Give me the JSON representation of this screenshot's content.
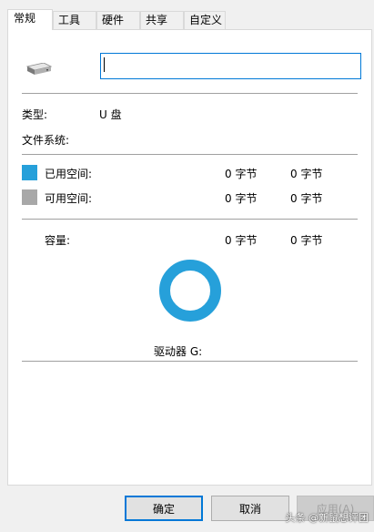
{
  "tabs": [
    {
      "label": "常规",
      "active": true
    },
    {
      "label": "工具",
      "active": false
    },
    {
      "label": "硬件",
      "active": false
    },
    {
      "label": "共享",
      "active": false
    },
    {
      "label": "自定义",
      "active": false
    }
  ],
  "drive": {
    "name_value": "",
    "icon": "usb-drive-icon",
    "type_label": "类型:",
    "type_value": "U 盘",
    "filesystem_label": "文件系统:",
    "filesystem_value": ""
  },
  "space": {
    "used_label": "已用空间:",
    "used_bytes": "0 字节",
    "used_size": "0 字节",
    "used_color": "#26a0da",
    "free_label": "可用空间:",
    "free_bytes": "0 字节",
    "free_size": "0 字节",
    "free_color": "#a8a8a8",
    "capacity_label": "容量:",
    "capacity_bytes": "0 字节",
    "capacity_size": "0 字节"
  },
  "drive_label": "驱动器 G:",
  "buttons": {
    "ok": "确定",
    "cancel": "取消",
    "apply": "应用(A)"
  },
  "watermark": "头条 @新鼠想评团",
  "colors": {
    "accent": "#0078d7",
    "ring": "#26a0da"
  }
}
